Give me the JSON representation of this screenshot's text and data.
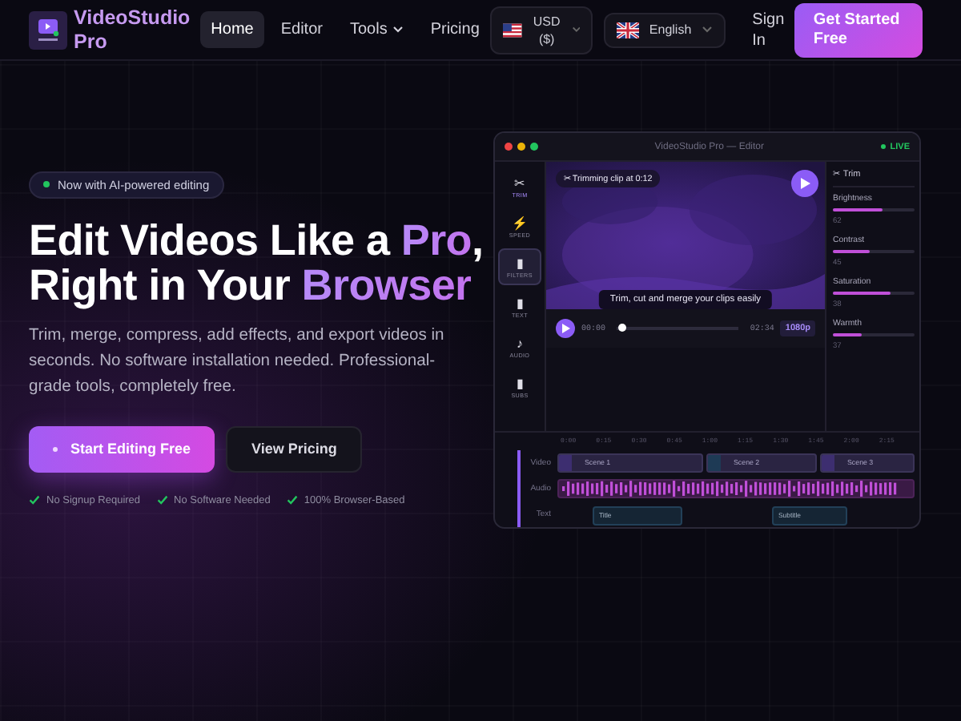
{
  "nav": {
    "brand": "VideoStudio Pro",
    "links": [
      {
        "label": "Home",
        "selected": true,
        "dropdown": false
      },
      {
        "label": "Editor",
        "selected": false,
        "dropdown": false
      },
      {
        "label": "Tools",
        "selected": false,
        "dropdown": true
      },
      {
        "label": "Pricing",
        "selected": false,
        "dropdown": false
      }
    ],
    "currency": "USD ($)",
    "language": "English",
    "sign_in": "Sign In",
    "cta": "Get Started Free"
  },
  "hero": {
    "badge": "Now with AI-powered editing",
    "headline": [
      [
        {
          "text": "Edit Videos Like a ",
          "accent": false
        },
        {
          "text": "Pro",
          "accent": true
        },
        {
          "text": ",",
          "accent": false
        }
      ],
      [
        {
          "text": "Right in Your ",
          "accent": false
        },
        {
          "text": "Browser",
          "accent": true
        }
      ]
    ],
    "description": "Trim, merge, compress, add effects, and export videos in seconds. No software installation needed. Professional-grade tools, completely free.",
    "primary_button": "Start Editing Free",
    "secondary_button": "View Pricing",
    "features": [
      "No Signup Required",
      "No Software Needed",
      "100% Browser-Based"
    ]
  },
  "editor": {
    "title": "VideoStudio Pro — Editor",
    "live": "LIVE",
    "tools": [
      {
        "icon": "✂",
        "label": "TRIM",
        "selected": false,
        "highlighted": true
      },
      {
        "icon": "⚡",
        "label": "SPEED",
        "selected": false,
        "highlighted": false
      },
      {
        "icon": "▮",
        "label": "FILTERS",
        "selected": true,
        "highlighted": false
      },
      {
        "icon": "▮",
        "label": "TEXT",
        "selected": false,
        "highlighted": false
      },
      {
        "icon": "♪",
        "label": "AUDIO",
        "selected": false,
        "highlighted": false
      },
      {
        "icon": "▮",
        "label": "SUBS",
        "selected": false,
        "highlighted": false
      }
    ],
    "preview": {
      "chip_icon": "✂",
      "chip": "Trimming clip at 0:12",
      "caption": "Trim, cut and merge your clips easily"
    },
    "playback": {
      "current": "00:00",
      "level": 0.04,
      "total": "02:34",
      "quality": "1080p"
    },
    "panel": {
      "icon": "✂",
      "title": "Trim",
      "adjustments": [
        {
          "name": "Brightness",
          "level": 0.6,
          "reading": "62"
        },
        {
          "name": "Contrast",
          "level": 0.45,
          "reading": "45"
        },
        {
          "name": "Saturation",
          "level": 0.7,
          "reading": "38"
        },
        {
          "name": "Warmth",
          "level": 0.35,
          "reading": "37"
        }
      ]
    },
    "timeline": {
      "ticks": [
        "0:00",
        "0:15",
        "0:30",
        "0:45",
        "1:00",
        "1:15",
        "1:30",
        "1:45",
        "2:00",
        "2:15"
      ],
      "tracks": [
        {
          "label": "Video",
          "kind": "clips",
          "clips": [
            "Scene 1",
            "Scene 2",
            "Scene 3"
          ]
        },
        {
          "label": "Audio",
          "kind": "waveform"
        },
        {
          "label": "Text",
          "kind": "captions",
          "clips": [
            "Title",
            "Subtitle"
          ]
        }
      ]
    }
  }
}
